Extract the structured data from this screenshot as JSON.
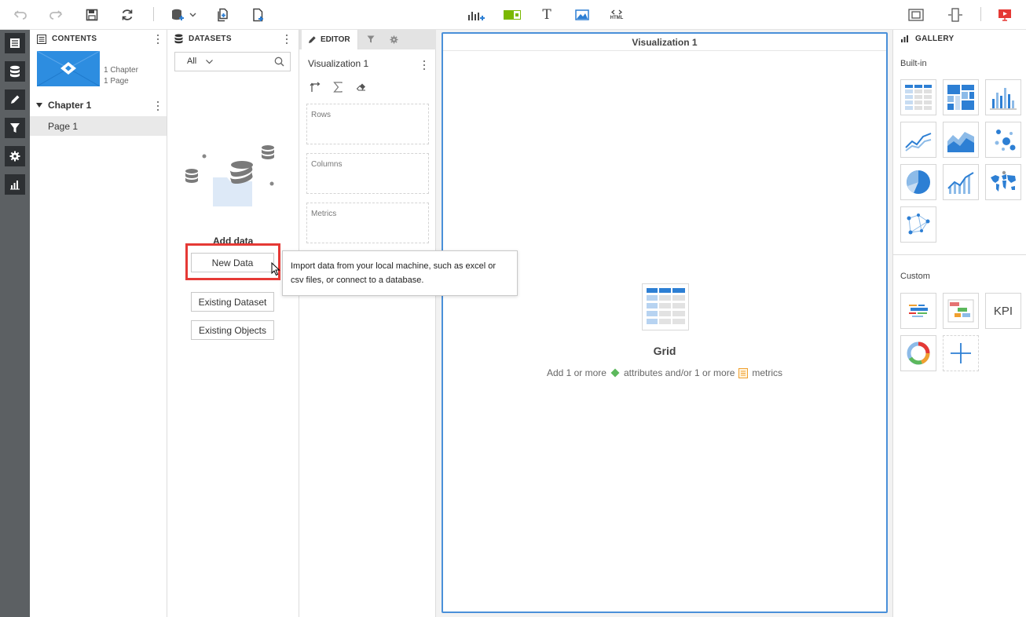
{
  "contents": {
    "title": "CONTENTS",
    "summary_chapters": "1 Chapter",
    "summary_pages": "1 Page",
    "chapter": "Chapter 1",
    "page": "Page 1"
  },
  "datasets": {
    "title": "DATASETS",
    "filter_value": "All",
    "add_data_label": "Add data",
    "new_data_button": "New Data",
    "existing_dataset_button": "Existing Dataset",
    "existing_objects_button": "Existing Objects"
  },
  "editor": {
    "tab_label": "EDITOR",
    "viz_name": "Visualization 1",
    "drop_zones": [
      "Rows",
      "Columns",
      "Metrics"
    ]
  },
  "canvas": {
    "title": "Visualization 1",
    "placeholder_title": "Grid",
    "hint_prefix": "Add 1 or more",
    "hint_middle": "attributes and/or 1 or more",
    "hint_suffix": "metrics"
  },
  "gallery": {
    "title": "GALLERY",
    "builtin_label": "Built-in",
    "custom_label": "Custom",
    "kpi_label": "KPI",
    "builtin_items": [
      "grid",
      "heat-map",
      "bar-chart",
      "line-chart",
      "area-chart",
      "bubble-chart",
      "pie-chart",
      "combo-chart",
      "map",
      "network"
    ],
    "custom_items": [
      "word-cloud",
      "gantt",
      "kpi",
      "donut",
      "add-custom"
    ]
  },
  "tooltip": {
    "text": "Import data from your local machine, such as excel or csv files, or connect to a database."
  },
  "toolbar": {
    "html_label": "HTML",
    "text_label": "T"
  },
  "colors": {
    "accent": "#4a90d9",
    "rail": "#5c6063",
    "highlight": "#e53935",
    "attribute": "#5cb85c",
    "metric": "#f0a030"
  }
}
